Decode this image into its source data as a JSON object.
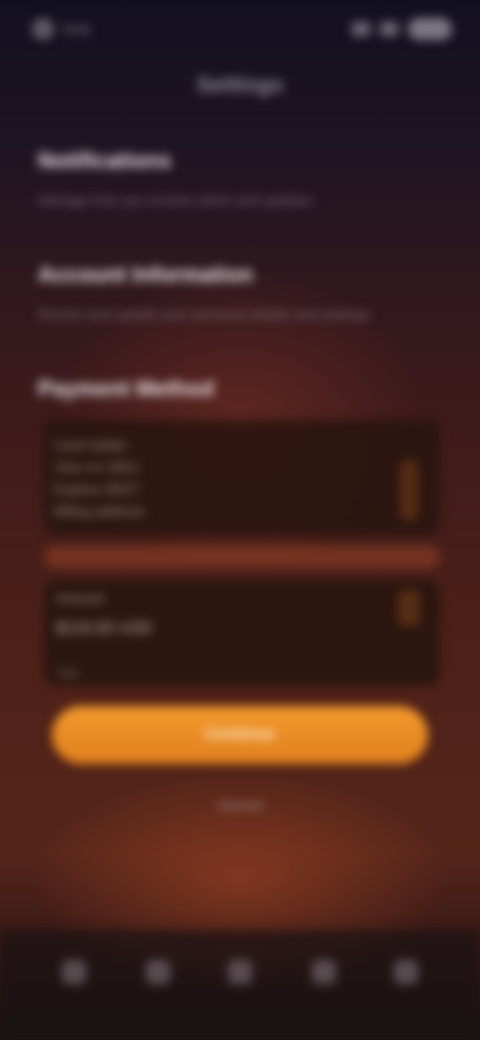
{
  "status_bar": {
    "time": "9:41"
  },
  "header": {
    "title": "Settings"
  },
  "sections": [
    {
      "title": "Notifications",
      "description": "Manage how you receive alerts and updates"
    },
    {
      "title": "Account Information",
      "description": "Review and update your personal details and settings"
    },
    {
      "title": "Payment Method"
    }
  ],
  "info_card": {
    "lines": [
      "Card holder",
      "Visa •••• 4821",
      "Expires 08/27",
      "Billing address"
    ]
  },
  "form": {
    "label": "Amount",
    "value": "$120.00 USD",
    "hint": "Fee"
  },
  "actions": {
    "primary_label": "Continue",
    "secondary_label": "Cancel"
  },
  "nav": {
    "items": [
      "home-icon",
      "search-icon",
      "wallet-icon",
      "chart-icon",
      "profile-icon"
    ]
  },
  "colors": {
    "accent": "#f0921f",
    "background_top": "#12101f",
    "background_bottom": "#55251a"
  }
}
